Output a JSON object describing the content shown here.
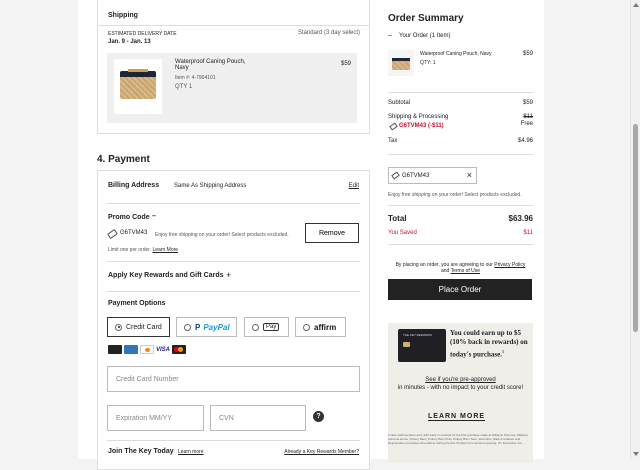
{
  "shipping": {
    "title": "Shipping",
    "est_label": "ESTIMATED DELIVERY DATE",
    "dates": "Jan. 9 - Jan. 13",
    "method": "Standard (3 day select)",
    "item": {
      "name": "Waterproof Caning Pouch, Navy",
      "number": "Item #: 4-7904101",
      "qty": "QTY 1",
      "price": "$59"
    }
  },
  "payment": {
    "heading": "4. Payment",
    "billing_label": "Billing Address",
    "billing_value": "Same As Shipping Address",
    "edit": "Edit",
    "promo_label": "Promo Code",
    "promo_toggle": "–",
    "promo_code": "G6TVM43",
    "promo_desc": "Enjoy free shipping on your order! Select products excluded.",
    "remove": "Remove",
    "limit": "Limit one per order.",
    "learn_more": "Learn More",
    "rewards_label": "Apply Key Rewards and Gift Cards",
    "rewards_plus": "+",
    "options_label": "Payment Options",
    "options": [
      "Credit Card",
      "PayPal",
      "Pay",
      "affirm"
    ],
    "paypal_p": "P",
    "apple": "",
    "card_logos": [
      "amex",
      "discover",
      "VISA",
      "mastercard"
    ],
    "visa": "VISA",
    "cc_placeholder": "Credit Card Number",
    "exp_placeholder": "Expiration MM/YY",
    "cvn_placeholder": "CVN",
    "help": "?",
    "join_label": "Join The Key Today",
    "join_learn": "Learn more",
    "member": "Already a Key Rewards Member?"
  },
  "summary": {
    "title": "Order Summary",
    "your_order": "Your Order (1 Item)",
    "collapse": "–",
    "item_name": "Waterproof Caning Pouch, Navy",
    "item_qty": "QTY: 1",
    "item_price": "$59",
    "subtotal_label": "Subtotal",
    "subtotal": "$59",
    "shipping_label": "Shipping & Processing",
    "shipping_old": "$11",
    "shipping_promo": "G6TVM43 (-$11)",
    "shipping_free": "Free",
    "tax_label": "Tax",
    "tax": "$4.96",
    "promo_chip": "G6TVM43",
    "chip_close": "×",
    "chip_desc": "Enjoy free shipping on your order! Select products excluded.",
    "total_label": "Total",
    "total": "$63.96",
    "saved_label": "You Saved",
    "saved": "$11",
    "agree_1": "By placing an order, you are agreeing to our",
    "privacy": "Privacy Policy",
    "agree_and": "and",
    "terms": "Terms of Use",
    "place_order": "Place Order"
  },
  "banner": {
    "card_text": "THE KEY REWARDS",
    "headline": "You could earn up to $5 (10% back in rewards) on today's purchase.",
    "sup": "1",
    "link": "See if you're pre-approved",
    "body": "in minutes - with no impact to your credit score!",
    "cta": "LEARN MORE",
    "fine": "1 New cardmembers earn 10% back in rewards for the first purchase made at Williams Sonoma, Williams Sonoma Home, Pottery Barn, Pottery Barn Kids, Pottery Barn Teen, West Elm, Mark & Graham and Rejuvenation (excludes GreenRow) during the first 30 days from account opening. On December 1st, ..."
  },
  "colors": {
    "accent_red": "#c8102e",
    "dark": "#222222",
    "border": "#dddddd"
  }
}
